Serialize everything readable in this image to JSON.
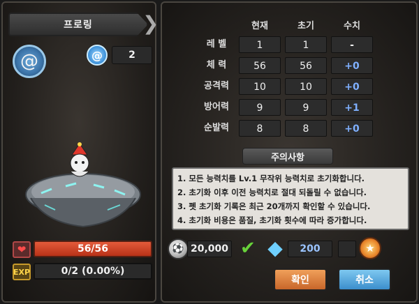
{
  "pet": {
    "name": "프로링",
    "level_value": "2",
    "hp": "56/56",
    "hp_fraction": 1.0,
    "exp": "0/2 (0.00%)",
    "exp_fraction": 0.0,
    "icons": {
      "badge": "snail-shell-icon",
      "level": "swirl-level-icon",
      "hp": "heart-icon",
      "exp": "exp-icon"
    },
    "exp_icon_text": "EXP"
  },
  "stats": {
    "headers": [
      "현재",
      "초기",
      "수치"
    ],
    "rows": [
      {
        "label": "레 벨",
        "current": "1",
        "initial": "1",
        "change": "-"
      },
      {
        "label": "체 력",
        "current": "56",
        "initial": "56",
        "change": "+0"
      },
      {
        "label": "공격력",
        "current": "10",
        "initial": "10",
        "change": "+0"
      },
      {
        "label": "방어력",
        "current": "9",
        "initial": "9",
        "change": "+1"
      },
      {
        "label": "순발력",
        "current": "8",
        "initial": "8",
        "change": "+0"
      }
    ]
  },
  "notice": {
    "title": "주의사항",
    "lines": [
      "1. 모든 능력치를 Lv.1 무작위 능력치로 초기화합니다.",
      "2. 초기화 이후 이전 능력치로 절대 되돌릴 수 없습니다.",
      "3. 펫 초기화 기록은 최근 20개까지 확인할 수 있습니다.",
      "4. 초기화 비용은 품질, 초기화 횟수에 따라 증가합니다."
    ]
  },
  "cost": {
    "coin": "20,000",
    "gem": "200",
    "icons": {
      "coin": "soccer-coin-icon",
      "check": "check-icon",
      "gem": "diamond-gem-icon",
      "ticket": "ticket-icon"
    }
  },
  "buttons": {
    "confirm": "확인",
    "cancel": "취소"
  },
  "colors": {
    "hp_bar": "#d2442a",
    "change_text": "#7fb0ff",
    "confirm_button": "#e08a45",
    "cancel_button": "#5aaee0",
    "notice_bg": "#e4e1dc"
  }
}
